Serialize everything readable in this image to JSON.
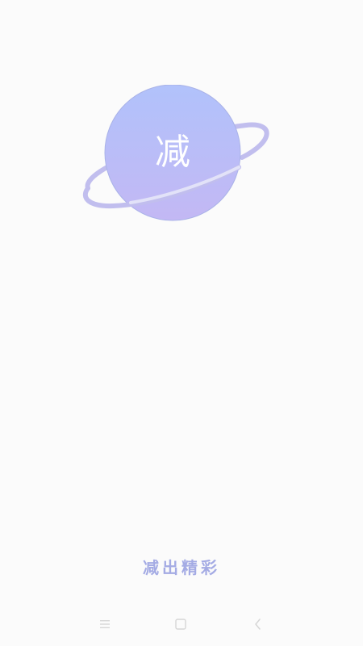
{
  "app": {
    "logo_char": "减",
    "slogan": "减出精彩"
  },
  "colors": {
    "background": "#fbfbfb",
    "planet_top": "#b1c2fb",
    "planet_bottom": "#c3b8f4",
    "ring": "#c1beee",
    "slogan": "#a4abe4",
    "nav_icon": "#d6d6d6"
  },
  "icons": {
    "nav_menu": "menu-icon",
    "nav_home": "home-square-icon",
    "nav_back": "back-chevron-icon"
  }
}
